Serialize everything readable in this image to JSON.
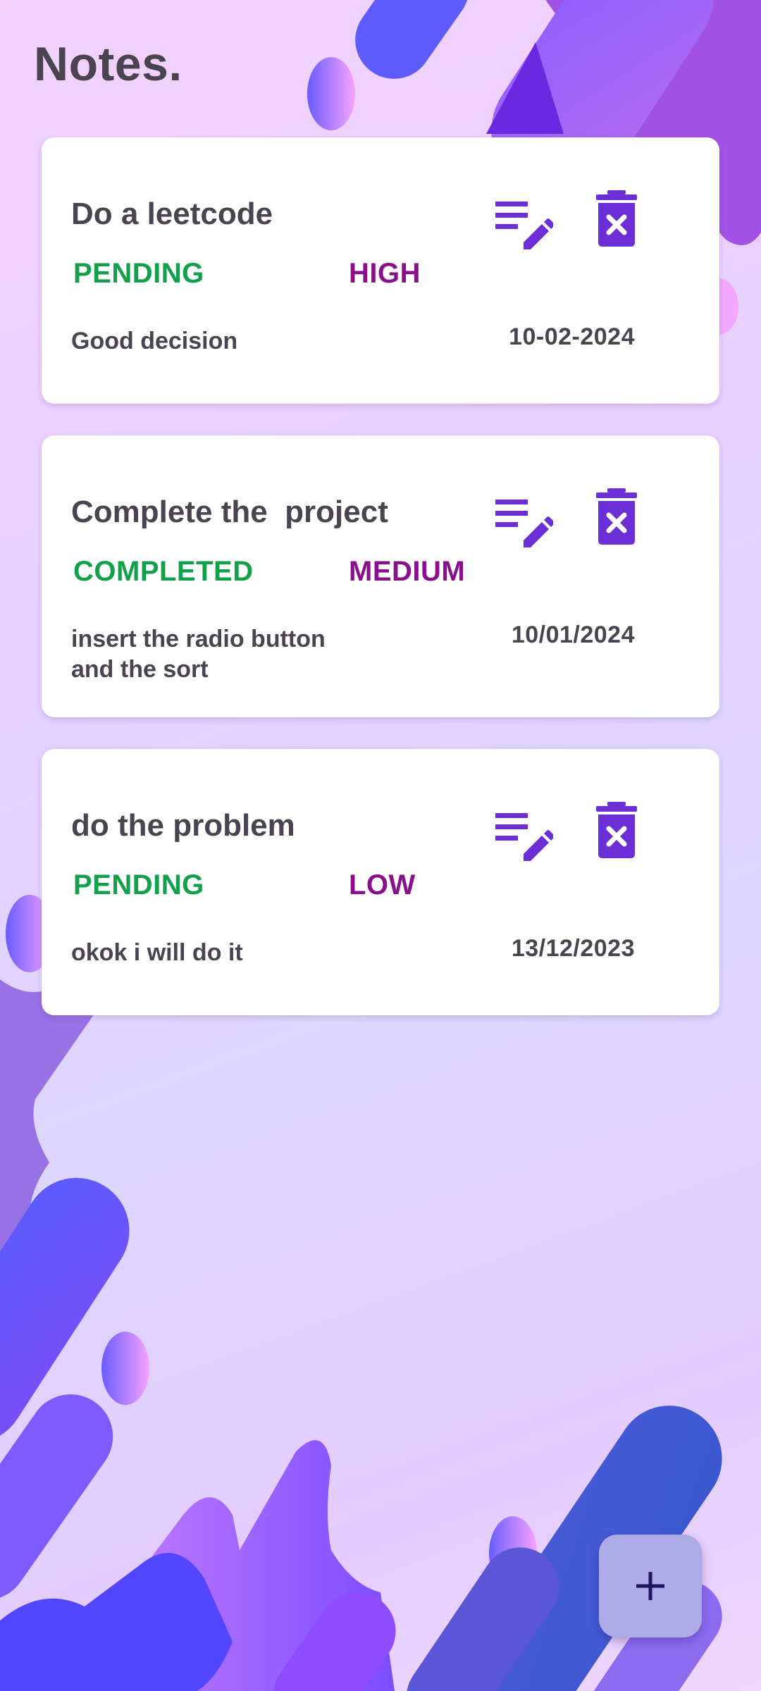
{
  "app": {
    "title": "Notes."
  },
  "notes": [
    {
      "title": "Do a leetcode",
      "status": "PENDING",
      "priority": "HIGH",
      "description": "Good decision",
      "date": "10-02-2024"
    },
    {
      "title": "Complete the  project",
      "status": "COMPLETED",
      "priority": "MEDIUM",
      "description": "insert the radio button and the sort",
      "date": "10/01/2024"
    },
    {
      "title": "do the problem",
      "status": "PENDING",
      "priority": "LOW",
      "description": "okok i will do it",
      "date": "13/12/2023"
    }
  ],
  "icons": {
    "edit": "edit-note-icon",
    "delete": "delete-forever-icon",
    "add": "plus-icon"
  },
  "colors": {
    "accent": "#6c2fd6",
    "status_green": "#12a04a",
    "priority_purple": "#8a0f8c",
    "text_dark": "#4a4450",
    "fab_bg": "#aeaae6"
  }
}
